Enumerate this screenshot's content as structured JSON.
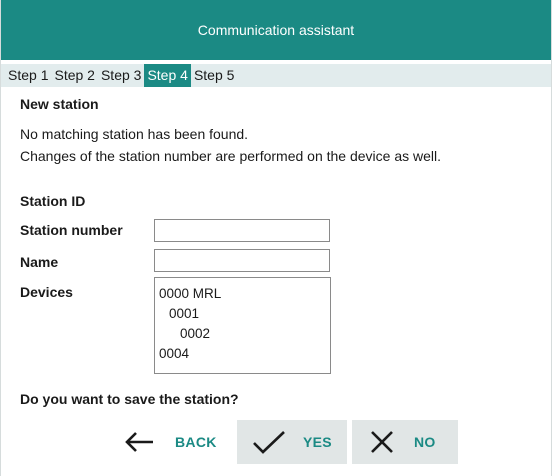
{
  "window": {
    "title": "Communication assistant"
  },
  "steps": [
    {
      "label": "Step 1",
      "active": false
    },
    {
      "label": "Step 2",
      "active": false
    },
    {
      "label": "Step 3",
      "active": false
    },
    {
      "label": "Step 4",
      "active": true
    },
    {
      "label": "Step 5",
      "active": false
    }
  ],
  "section": {
    "heading": "New station",
    "message_line1": "No matching station has been found.",
    "message_line2": "Changes of the station number are performed on the device as well."
  },
  "station": {
    "heading": "Station ID",
    "number_label": "Station number",
    "number_value": "",
    "name_label": "Name",
    "name_value": "",
    "devices_label": "Devices",
    "devices": [
      "0000 MRL",
      "0001",
      "0002",
      "0004"
    ]
  },
  "question": "Do you want to save the station?",
  "actions": {
    "back_label": "BACK",
    "yes_label": "YES",
    "no_label": "NO",
    "accent_color": "#1b8a84"
  }
}
